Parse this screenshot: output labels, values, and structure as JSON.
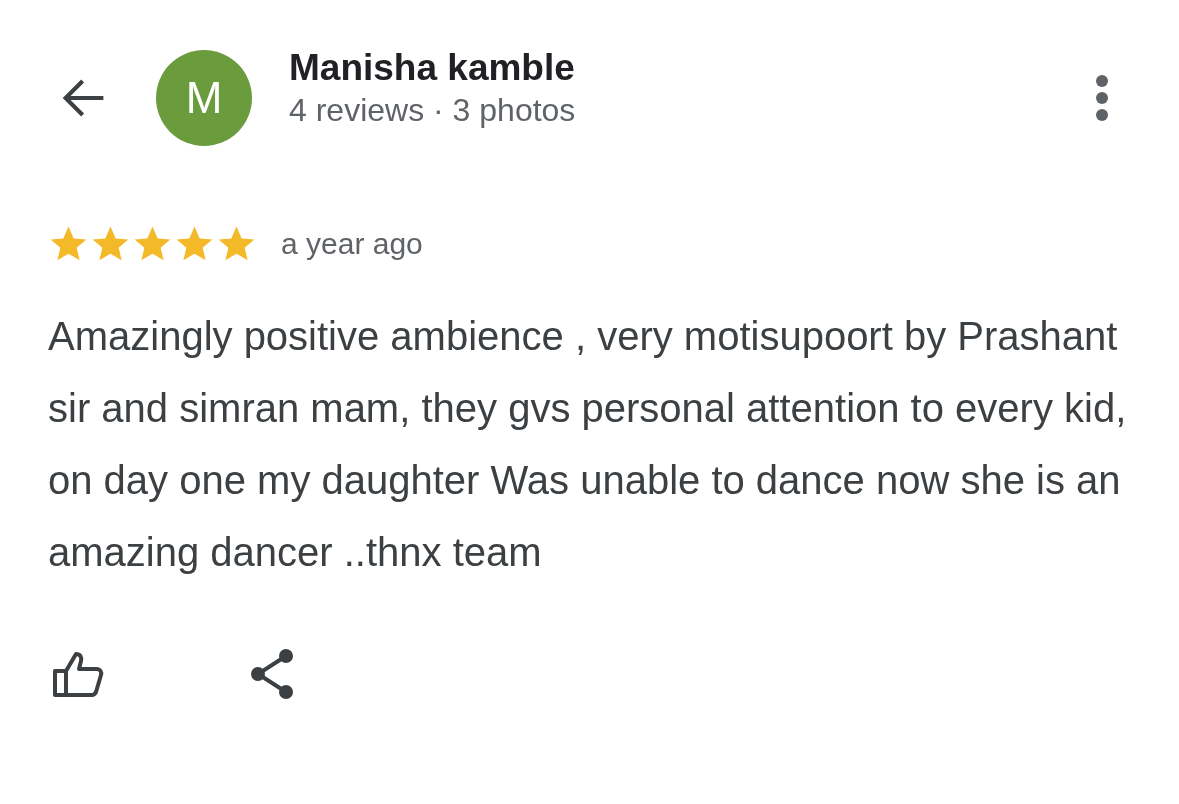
{
  "reviewer": {
    "initial": "M",
    "name": "Manisha kamble",
    "stats": "4 reviews · 3 photos"
  },
  "review": {
    "stars": 5,
    "time": "a year ago",
    "text": "Amazingly positive ambience , very motisupoort by Prashant sir and simran mam, they gvs personal attention to every kid, on day one my daughter Was unable to dance now she is an amazing dancer ..thnx team"
  }
}
